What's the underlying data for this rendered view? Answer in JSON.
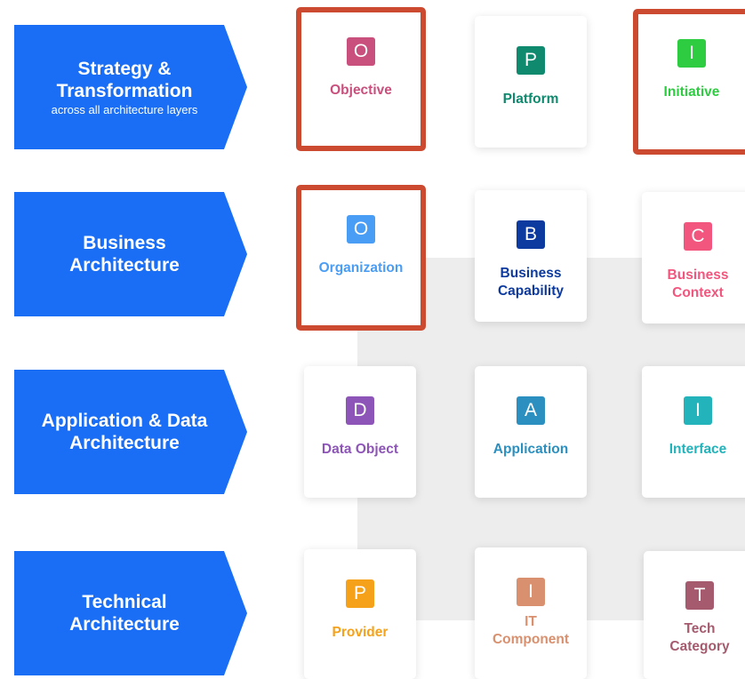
{
  "layers": [
    {
      "title": "Strategy &\nTransformation",
      "subtitle": "across all architecture layers"
    },
    {
      "title": "Business\nArchitecture",
      "subtitle": ""
    },
    {
      "title": "Application & Data\nArchitecture",
      "subtitle": ""
    },
    {
      "title": "Technical\nArchitecture",
      "subtitle": ""
    }
  ],
  "cards": [
    {
      "letter": "O",
      "label": "Objective",
      "color": "#c94f7c",
      "highlighted": true
    },
    {
      "letter": "P",
      "label": "Platform",
      "color": "#0f8a6e",
      "highlighted": false
    },
    {
      "letter": "I",
      "label": "Initiative",
      "color": "#2ecc40",
      "highlighted": true
    },
    {
      "letter": "O",
      "label": "Organization",
      "color": "#4a9df5",
      "highlighted": true
    },
    {
      "letter": "B",
      "label": "Business\nCapability",
      "color": "#0d3a9e",
      "highlighted": false
    },
    {
      "letter": "C",
      "label": "Business\nContext",
      "color": "#f2557e",
      "highlighted": false
    },
    {
      "letter": "D",
      "label": "Data Object",
      "color": "#8e55b8",
      "highlighted": false
    },
    {
      "letter": "A",
      "label": "Application",
      "color": "#2b8fbf",
      "highlighted": false
    },
    {
      "letter": "I",
      "label": "Interface",
      "color": "#22b3bb",
      "highlighted": false
    },
    {
      "letter": "P",
      "label": "Provider",
      "color": "#f5a11a",
      "highlighted": false
    },
    {
      "letter": "I",
      "label": "IT\nComponent",
      "color": "#d8906e",
      "highlighted": false
    },
    {
      "letter": "T",
      "label": "Tech\nCategory",
      "color": "#a55a6e",
      "highlighted": false
    }
  ]
}
